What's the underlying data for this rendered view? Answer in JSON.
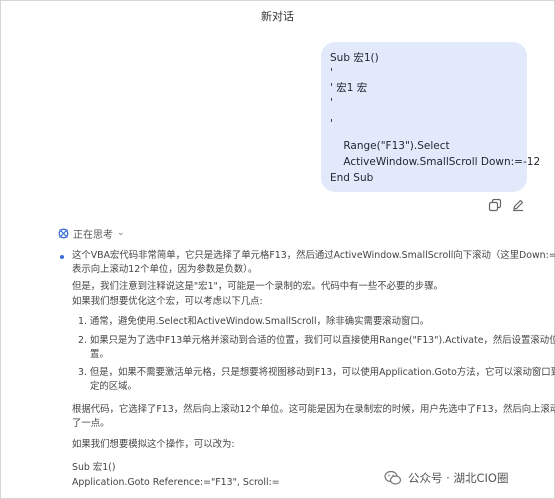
{
  "header": {
    "title": "新对话"
  },
  "user_message": {
    "lines": [
      "Sub 宏1()",
      "'",
      "' 宏1 宏",
      "'",
      "'",
      "    Range(\"F13\").Select",
      "    ActiveWindow.SmallScroll Down:=-12",
      "End Sub"
    ]
  },
  "message_actions": {
    "copy_icon": "copy-icon",
    "edit_icon": "edit-icon"
  },
  "thinking": {
    "label": "正在思考",
    "lines": [
      "这个VBA宏代码非常简单，它只是选择了单元格F13，然后通过ActiveWindow.SmallScroll向下滚动（这里Down:=-12",
      "表示向上滚动12个单位，因为参数是负数）。",
      "但是，我们注意到注释说这是\"宏1\"，可能是一个录制的宏。代码中有一些不必要的步骤。",
      "如果我们想要优化这个宏，可以考虑以下几点:",
      "1. 通常，避免使用.Select和ActiveWindow.SmallScroll，除非确实需要滚动窗口。",
      "2. 如果只是为了选中F13单元格并滚动到合适的位置，我们可以直接使用Range(\"F13\").Activate，然后设置滚动位",
      "置。",
      "3. 但是，如果不需要激活单元格，只是想要将视图移动到F13，可以使用Application.Goto方法，它可以滚动窗口到指",
      "定的区域。",
      "根据代码，它选择了F13，然后向上滚动12个单位。这可能是因为在录制宏的时候，用户先选中了F13，然后向上滚动",
      "了一点。",
      "如果我们想要模拟这个操作，可以改为:",
      "Sub 宏1()",
      "Application.Goto Reference:=\"F13\", Scroll:="
    ]
  },
  "watermark": {
    "text": "公众号 · 湖北CIO圈"
  },
  "colors": {
    "bubble": "#e1e9fb",
    "accent": "#3a6fd8"
  }
}
